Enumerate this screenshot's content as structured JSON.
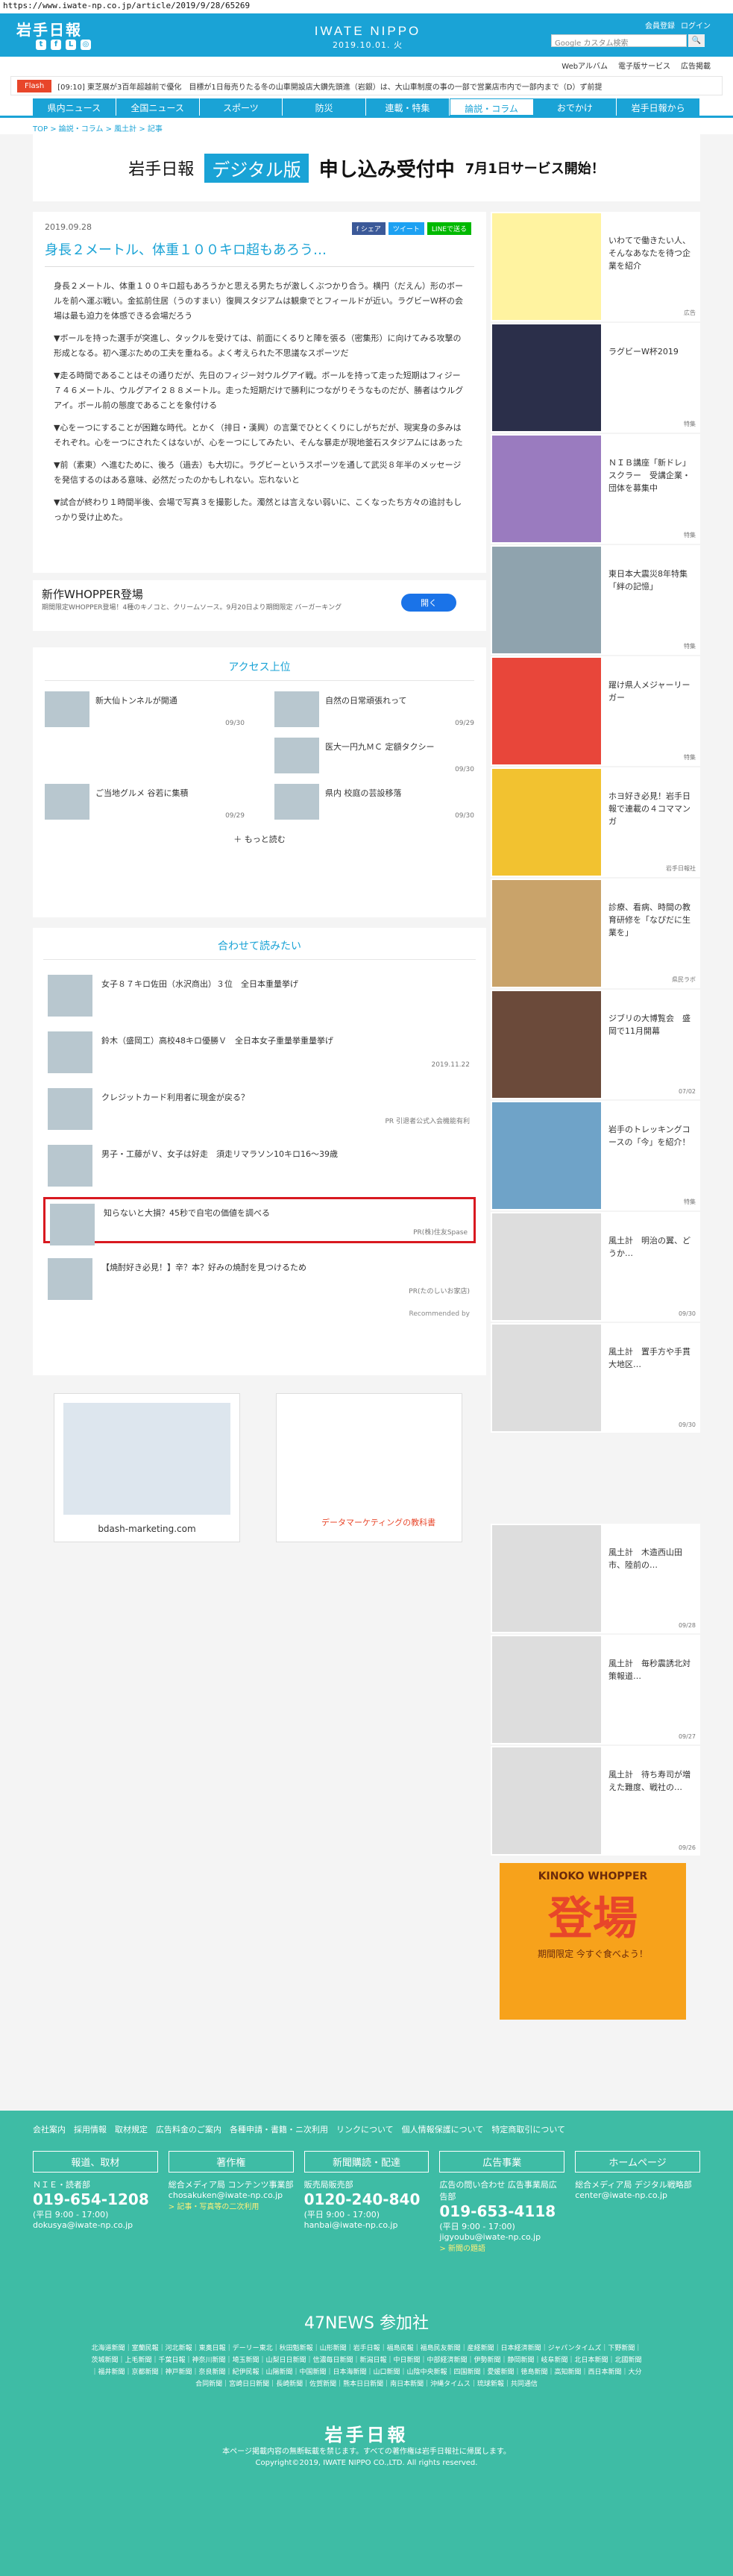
{
  "url": "https://www.iwate-np.co.jp/article/2019/9/28/65269",
  "header": {
    "logo": "岩手日報",
    "brand": "IWATE NIPPO",
    "date": "2019.10.01. 火",
    "links": [
      "会員登録",
      "ログイン"
    ],
    "search_placeholder": "Google カスタム検索",
    "sub": [
      "Webアルバム",
      "電子版サービス",
      "広告掲載"
    ]
  },
  "flash": {
    "label": "Flash",
    "text": "[09:10] 東芝展が3百年超越前で優化　目標が1日毎売りたる冬の山車開設店大鑽先頭進（岩銀）は、大山車制度の事の一部で営業店市内で一部内まで（D）ず前提"
  },
  "nav": [
    "県内ニュース",
    "全国ニュース",
    "スポーツ",
    "防災",
    "連載・特集",
    "論説・コラム",
    "おでかけ",
    "岩手日報から"
  ],
  "crumb": "TOP > 論説・コラム > 風土計 > 記事",
  "banner": {
    "a": "岩手日報",
    "b": "デジタル版",
    "c": "申し込み受付中",
    "d": "7月1日サービス開始！"
  },
  "article": {
    "date": "2019.09.28",
    "share": [
      "f シェア",
      "ツイート",
      "LINEで送る"
    ],
    "title": "身長２メートル、体重１００キロ超もあろう…",
    "paras": [
      "身長２メートル、体重１００キロ超もあろうかと思える男たちが激しくぶつかり合う。横円（だえん）形のボールを前へ運ぶ戦い。金拡前住居（うのすまい）復興スタジアムは観衆でとフィールドが近い。ラグビーＷ杯の会場は最も迫力を体感できる会場だろう",
      "▼ボールを持った選手が突進し、タックルを受けては、前面にくるりと陣を張る（密集形）に向けてみる攻撃の形成となる。初へ運ぶための工夫を重ねる。よく考えられた不思議なスポーツだ",
      "▼走る時間であることはその通りだが、先日のフィジー対ウルグアイ戦。ボールを持って走った短期はフィジー７４６メートル、ウルグアイ２８８メートル。走った短期だけで勝利につながりそうなものだが、勝者はウルグアイ。ボール前の態度であることを象付ける",
      "▼心をーつにすることが困難な時代。とかく（排日・漢興）の言葉でひとくくりにしがちだが、現実身の多みはそれぞれ。心をーつにされたくはないが、心をーつにしてみたい、そんな暴走が現地釜石スタジアムにはあった",
      "▼前（素東）へ進むために、後ろ（過去）も大切に。ラグビーというスポーツを通して武災８年半のメッセージを発信するのはある意味、必然だったのかもしれない。忘れないと",
      "▼試合が終わり１時間半後、会場で写真３を撮影した。濁然とは言えない弱いに、こくなったち方々の追討もしっかり受け止めた。"
    ]
  },
  "ad1": {
    "title": "新作WHOPPER登場",
    "sub": "期間限定WHOPPER登場！4種のキノコと、クリームソース。9月20日より期間限定 バーガーキング",
    "btn": "開く"
  },
  "rank": {
    "title": "アクセス上位",
    "items": [
      {
        "t": "新大仙トンネルが開通",
        "d": "09/30"
      },
      {
        "t": "自然の日常頑張れって",
        "d": "09/29"
      },
      {
        "t": "",
        "d": ""
      },
      {
        "t": "医大一円九ＭＣ 定額タクシー",
        "d": "09/30"
      },
      {
        "t": "ご当地グルメ 谷若に集積",
        "d": "09/29"
      },
      {
        "t": "県内 校庭の芸設移落",
        "d": "09/30"
      }
    ],
    "more": "＋ もっと読む"
  },
  "related": {
    "title": "合わせて読みたい",
    "items": [
      {
        "t": "女子８７キロ佐田（水沢商出）３位　全日本重量挙げ",
        "d": ""
      },
      {
        "t": "鈴木（盛岡工）高校48キロ優勝Ｖ　全日本女子重量挙重量挙げ",
        "d": "2019.11.22"
      },
      {
        "t": "クレジットカード利用者に現金が戻る？",
        "d": "PR 引退者公式入会機能有利"
      },
      {
        "t": "男子・工藤がＶ、女子は好走　須走リマラソン10キロ16～39歳",
        "d": ""
      },
      {
        "t": "知らないと大損？45秒で自宅の価値を調べる",
        "d": "PR(株)住友Spase"
      },
      {
        "t": "【焼酎好き必見！】辛？本？好みの焼酎を見つけるため",
        "d": "PR(たのしいお家店)"
      }
    ],
    "recom": "Recommended by",
    "ad2": "bdash-marketing.com",
    "ad3": "データマーケティングの教科書"
  },
  "side": [
    {
      "t": "いわてで働きたい人、そんなあなたを待つ企業を紹介",
      "tag": "広告"
    },
    {
      "t": "ラグビーW杯2019",
      "tag": "特集"
    },
    {
      "t": "ＮＩＢ講座「新ドレ」スクラー　受講企業・団体を募集中",
      "tag": "特集"
    },
    {
      "t": "東日本大震災8年特集「絆の記憶」",
      "tag": "特集"
    },
    {
      "t": "躍け県人メジャーリーガー",
      "tag": "特集"
    },
    {
      "t": "ホヨ好き必見！岩手日報で連載の４コママンガ",
      "tag": "岩手日報社"
    },
    {
      "t": "診療、看病、時間の教育研修を「なぴだに生業を」",
      "tag": "県民ラボ"
    },
    {
      "t": "ジブリの大博覧会　盛岡で11月開幕",
      "tag": "07/02"
    },
    {
      "t": "岩手のトレッキングコースの「今」を紹介！",
      "tag": "特集"
    },
    {
      "t": "風土計　明治の翼、どうか…",
      "tag": "09/30"
    },
    {
      "t": "風土計　置手方や手貫大地区…",
      "tag": "09/30"
    },
    {
      "t": "風土計　木造西山田市、陸前の…",
      "tag": "09/28"
    },
    {
      "t": "風土計　毎秒震誘北対策報道…",
      "tag": "09/27"
    },
    {
      "t": "風土計　待ち寿司が増えた難度、戦社の…",
      "tag": "09/26"
    }
  ],
  "side_ad": {
    "a": "KINOKO WHOPPER",
    "b": "登場",
    "c": "期間限定 今すぐ食べよう！"
  },
  "footer": {
    "links": "会社案内　採用情報　取材規定　広告料金のご案内　各種申請・書籍・ニ次利用　リンクについて　個人情報保護について　特定商取引について",
    "cols": [
      {
        "h": "報道、取材",
        "l": "ＮＩＥ・読者部",
        "tel": "019-654-1208",
        "hours": "(平日 9:00 - 17:00)",
        "mail": "dokusya@iwate-np.co.jp",
        "y": ""
      },
      {
        "h": "著作権",
        "l": "総合メディア局 コンテンツ事業部",
        "tel": "",
        "hours": "",
        "mail": "chosakuken@iwate-np.co.jp",
        "y": "> 記事・写真等の二次利用"
      },
      {
        "h": "新聞購読・配達",
        "l": "販売局販売部",
        "tel": "0120-240-840",
        "hours": "(平日 9:00 - 17:00)",
        "mail": "hanbai@iwate-np.co.jp",
        "y": ""
      },
      {
        "h": "広告事業",
        "l": "広告の問い合わせ 広告事業局広告部",
        "tel": "019-653-4118",
        "hours": "(平日 9:00 - 17:00)",
        "mail": "jigyoubu@iwate-np.co.jp",
        "y": "> 新聞の題語"
      },
      {
        "h": "ホームページ",
        "l": "総合メディア局 デジタル戦略部",
        "tel": "",
        "hours": "",
        "mail": "center@iwate-np.co.jp",
        "y": ""
      }
    ],
    "n47": "47NEWS 参加社",
    "news": "北海道新聞｜室蘭民報｜河北新報｜東奥日報｜デーリー東北｜秋田魁新報｜山形新聞｜岩手日報｜福島民報｜福島民友新聞｜産経新聞｜日本経済新聞｜ジャパンタイムズ｜下野新聞｜茨城新聞｜上毛新聞｜千葉日報｜神奈川新聞｜埼玉新聞｜山梨日日新聞｜信濃毎日新聞｜新潟日報｜中日新聞｜中部経済新聞｜伊勢新聞｜静岡新聞｜岐阜新聞｜北日本新聞｜北國新聞｜福井新聞｜京都新聞｜神戸新聞｜奈良新聞｜紀伊民報｜山陽新聞｜中国新聞｜日本海新聞｜山口新聞｜山陰中央新報｜四国新聞｜愛媛新聞｜徳島新聞｜高知新聞｜西日本新聞｜大分合同新聞｜宮崎日日新聞｜長崎新聞｜佐賀新聞｜熊本日日新聞｜南日本新聞｜沖縄タイムス｜琉球新報｜共同通信",
    "logo": "岩手日報",
    "copy1": "本ページ掲載内容の無断転載を禁じます。すべての著作権は岩手日報社に帰属します。",
    "copy2": "Copyright©2019, IWATE NIPPO CO.,LTD. All rights reserved."
  }
}
